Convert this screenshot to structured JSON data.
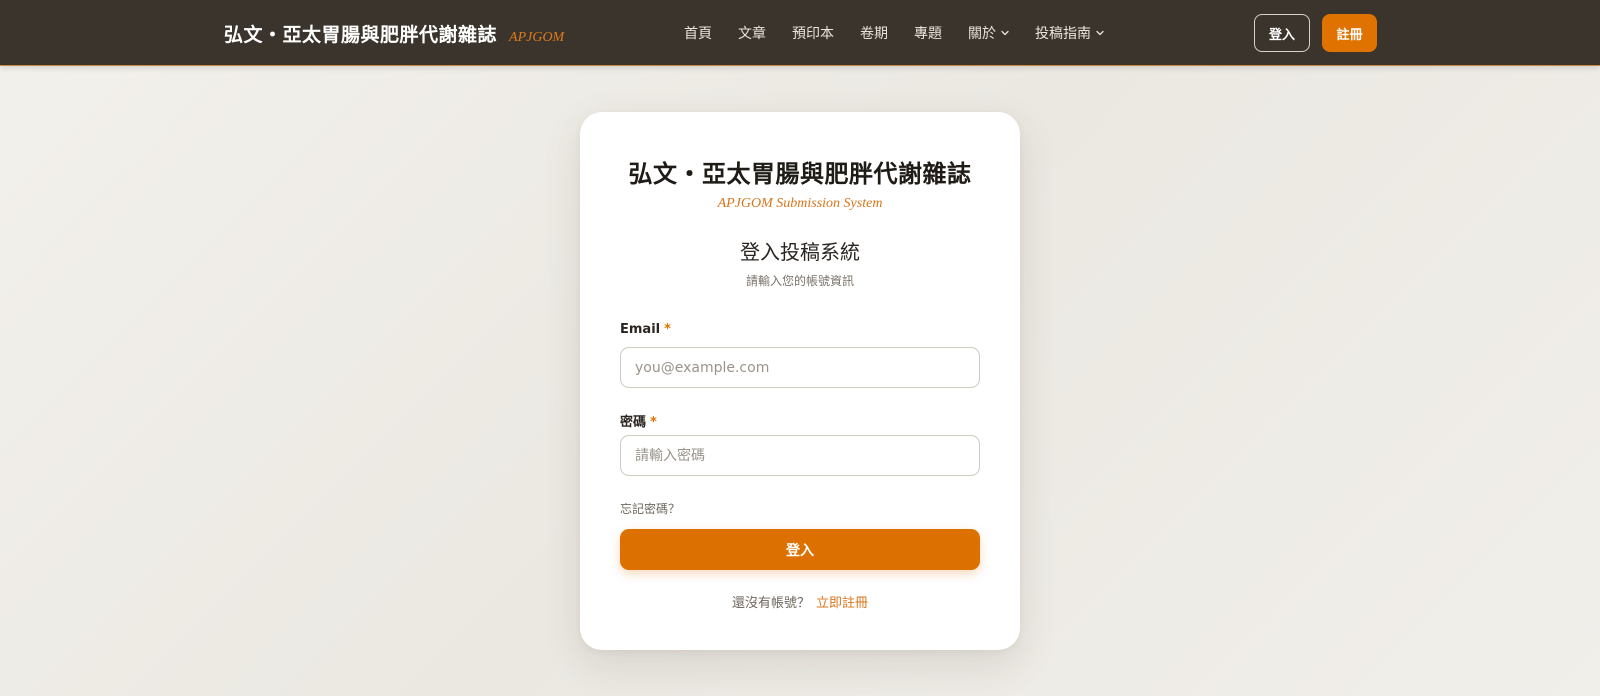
{
  "header": {
    "brand_title": "弘文・亞太胃腸與肥胖代謝雜誌",
    "brand_abbr": "APJGOM",
    "nav": [
      {
        "label": "首頁",
        "has_dropdown": false
      },
      {
        "label": "文章",
        "has_dropdown": false
      },
      {
        "label": "預印本",
        "has_dropdown": false
      },
      {
        "label": "卷期",
        "has_dropdown": false
      },
      {
        "label": "專題",
        "has_dropdown": false
      },
      {
        "label": "關於",
        "has_dropdown": true
      },
      {
        "label": "投稿指南",
        "has_dropdown": true
      }
    ],
    "login_label": "登入",
    "register_label": "註冊"
  },
  "card": {
    "title": "弘文・亞太胃腸與肥胖代謝雜誌",
    "subtitle": "APJGOM Submission System",
    "heading": "登入投稿系統",
    "hint": "請輸入您的帳號資訊",
    "email": {
      "label": "Email",
      "required_mark": "*",
      "placeholder": "you@example.com",
      "value": ""
    },
    "password": {
      "label": "密碼",
      "required_mark": "*",
      "placeholder": "請輸入密碼",
      "value": ""
    },
    "forgot_label": "忘記密碼？",
    "submit_label": "登入",
    "no_account_text": "還沒有帳號？",
    "register_link": "立即註冊"
  },
  "colors": {
    "header_bg": "#3a342c",
    "accent": "#e07200",
    "page_bg": "#efede8",
    "card_bg": "#ffffff"
  }
}
